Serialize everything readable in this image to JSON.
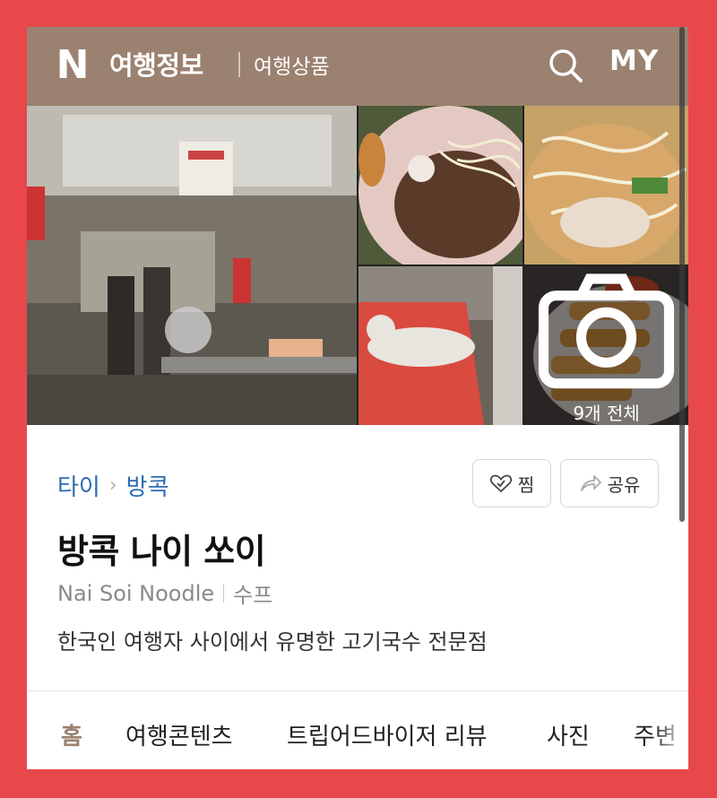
{
  "header": {
    "logo": "N",
    "title": "여행정보",
    "subtitle": "여행상품",
    "search_icon": "search-icon",
    "my_label": "MY",
    "bg_color": "#9b8170"
  },
  "gallery": {
    "photo_count_label": "9개 전체",
    "camera_icon": "camera-icon"
  },
  "place": {
    "breadcrumb": [
      "타이",
      "방콕"
    ],
    "save_label": "찜",
    "share_label": "공유",
    "name": "방콕 나이 쏘이",
    "english_name": "Nai Soi Noodle",
    "category": "수프",
    "description": "한국인 여행자 사이에서 유명한 고기국수 전문점"
  },
  "tabs": [
    "홈",
    "여행콘텐츠",
    "트립어드바이저 리뷰",
    "사진",
    "주변"
  ],
  "colors": {
    "frame": "#e8484b",
    "header": "#9b8170",
    "link": "#2b6cb3"
  }
}
